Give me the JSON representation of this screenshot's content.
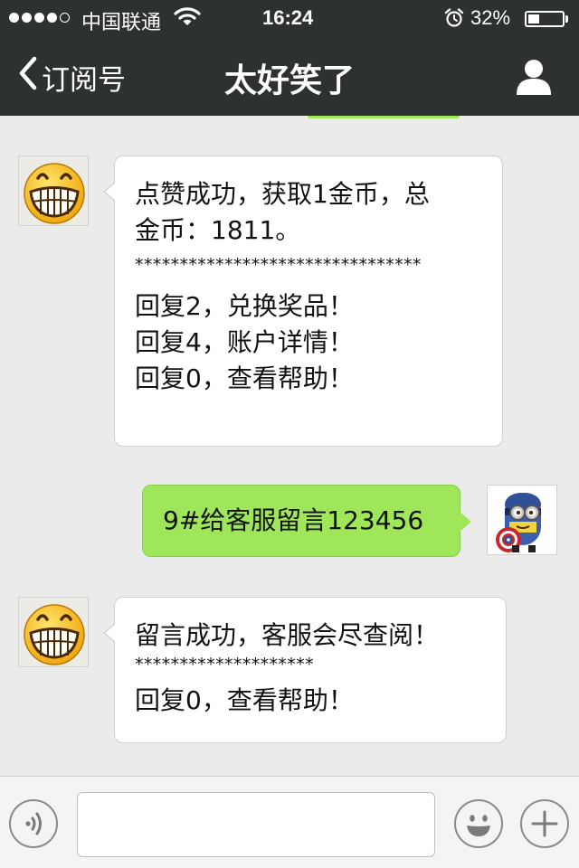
{
  "status_bar": {
    "carrier": "中国联通",
    "time": "16:24",
    "battery_percent": "32%",
    "battery_level": 0.32,
    "signal_bars": 4,
    "signal_max": 5
  },
  "nav": {
    "back_label": "订阅号",
    "title": "太好笑了"
  },
  "messages": [
    {
      "side": "left",
      "lines": [
        "点赞成功，获取1金币，总",
        "金币：1811。"
      ],
      "separator": "********************************",
      "lines2": [
        "回复2，兑换奖品！",
        "回复4，账户详情！",
        "回复0，查看帮助！"
      ]
    },
    {
      "side": "right",
      "text": "9#给客服留言123456"
    },
    {
      "side": "left",
      "lines": [
        "留言成功，客服会尽查阅！"
      ],
      "separator": "********************",
      "lines2": [
        "回复0，查看帮助！"
      ]
    }
  ],
  "input": {
    "value": "",
    "placeholder": ""
  },
  "colors": {
    "header_bg": "#2e3132",
    "chat_bg": "#ebebeb",
    "sent_bubble": "#9fe65a",
    "received_bubble": "#ffffff"
  }
}
